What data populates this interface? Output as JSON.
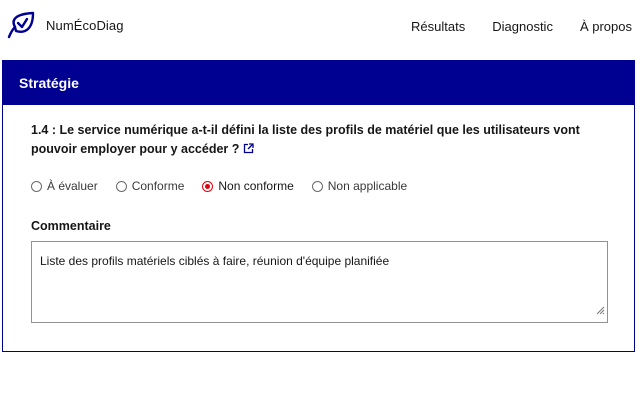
{
  "header": {
    "brand_name": "NumÉcoDiag",
    "logo_icon": "leaf-check-logo-icon",
    "nav": [
      {
        "label": "Résultats"
      },
      {
        "label": "Diagnostic"
      },
      {
        "label": "À propos"
      }
    ]
  },
  "card": {
    "title": "Stratégie",
    "question": "1.4 : Le service numérique a-t-il défini la liste des profils de matériel que les utilisateurs vont pouvoir employer pour y accéder ?",
    "external_link_icon": "external-link-icon",
    "options": [
      {
        "label": "À évaluer",
        "checked": false
      },
      {
        "label": "Conforme",
        "checked": false
      },
      {
        "label": "Non conforme",
        "checked": true
      },
      {
        "label": "Non applicable",
        "checked": false
      }
    ],
    "comment_label": "Commentaire",
    "comment_value": "Liste des profils matériels ciblés à faire, réunion d'équipe planifiée"
  },
  "colors": {
    "primary": "#000091",
    "selected_radio": "#e1000f",
    "text": "#161616"
  }
}
